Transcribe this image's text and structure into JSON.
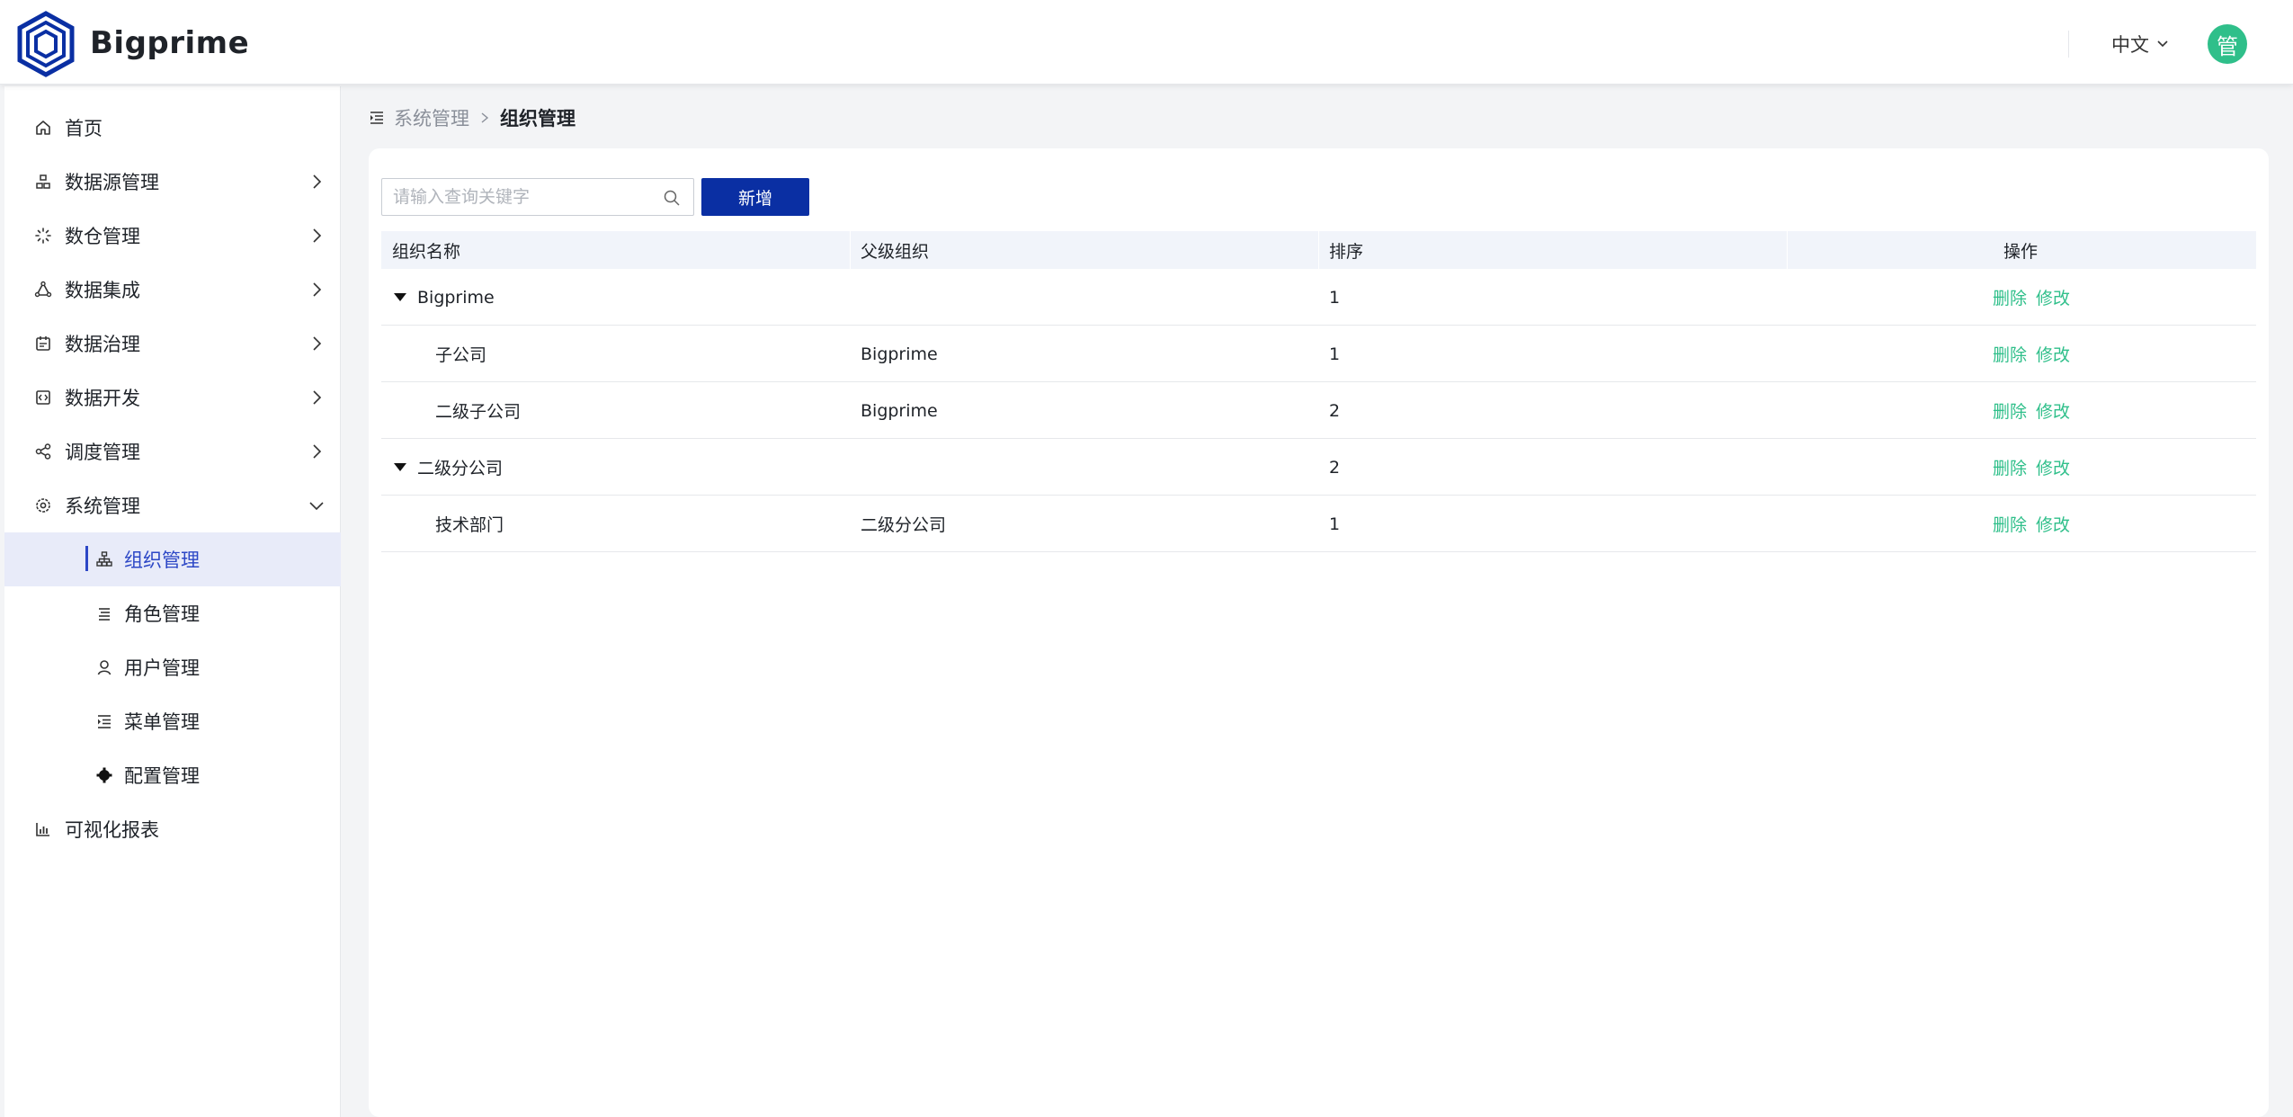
{
  "app": {
    "name": "Bigprime"
  },
  "header": {
    "language": "中文",
    "avatar_text": "管"
  },
  "sidebar": {
    "items": [
      {
        "label": "首页",
        "icon": "home-icon"
      },
      {
        "label": "数据源管理",
        "icon": "datasource-icon"
      },
      {
        "label": "数仓管理",
        "icon": "warehouse-icon"
      },
      {
        "label": "数据集成",
        "icon": "integration-icon"
      },
      {
        "label": "数据治理",
        "icon": "governance-icon"
      },
      {
        "label": "数据开发",
        "icon": "code-icon"
      },
      {
        "label": "调度管理",
        "icon": "share-icon"
      },
      {
        "label": "系统管理",
        "icon": "gear-icon"
      }
    ],
    "sub_items": [
      {
        "label": "组织管理",
        "icon": "org-icon",
        "active": true
      },
      {
        "label": "角色管理",
        "icon": "role-icon"
      },
      {
        "label": "用户管理",
        "icon": "user-icon"
      },
      {
        "label": "菜单管理",
        "icon": "menu-icon"
      },
      {
        "label": "配置管理",
        "icon": "config-icon"
      }
    ],
    "last_item": {
      "label": "可视化报表",
      "icon": "chart-icon"
    }
  },
  "breadcrumb": {
    "parent": "系统管理",
    "current": "组织管理"
  },
  "toolbar": {
    "search_placeholder": "请输入查询关键字",
    "add_label": "新增"
  },
  "table": {
    "headers": [
      "组织名称",
      "父级组织",
      "排序",
      "操作"
    ],
    "actions": {
      "delete": "删除",
      "edit": "修改"
    },
    "rows": [
      {
        "name": "Bigprime",
        "parent": "",
        "order": "1",
        "level": 0,
        "expanded": true
      },
      {
        "name": "子公司",
        "parent": "Bigprime",
        "order": "1",
        "level": 1
      },
      {
        "name": "二级子公司",
        "parent": "Bigprime",
        "order": "2",
        "level": 1
      },
      {
        "name": "二级分公司",
        "parent": "",
        "order": "2",
        "level": 0,
        "expanded": true
      },
      {
        "name": "技术部门",
        "parent": "二级分公司",
        "order": "1",
        "level": 1
      }
    ]
  },
  "colors": {
    "primary": "#0a2fa3",
    "accent": "#2c47c6",
    "link": "#2fbf8a",
    "avatar": "#2fbf8a"
  }
}
